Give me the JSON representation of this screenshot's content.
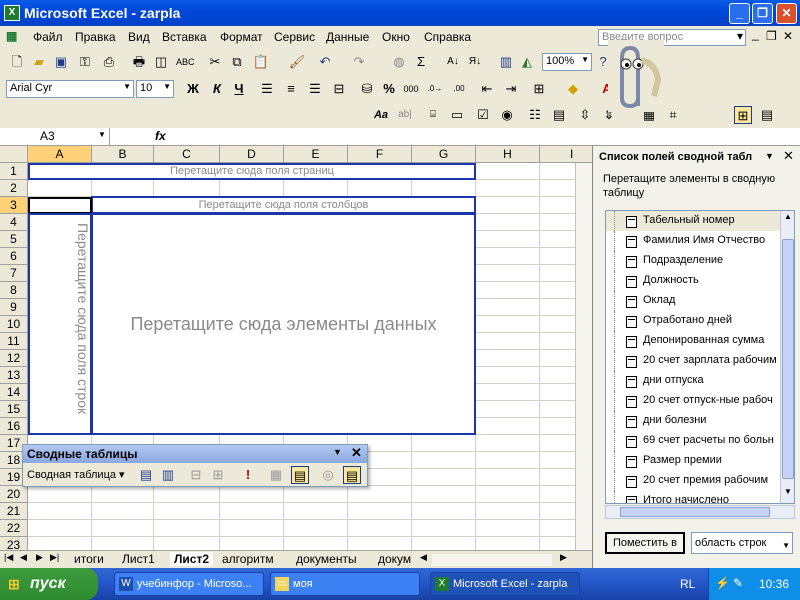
{
  "window": {
    "title": "Microsoft Excel - zarpla",
    "app_icon": "excel-icon",
    "minimize": "_",
    "maximize": "❐",
    "close": "✕"
  },
  "menu": {
    "items": [
      "Файл",
      "Правка",
      "Вид",
      "Вставка",
      "Формат",
      "Сервис",
      "Данные",
      "Окно",
      "Справка"
    ],
    "help_placeholder": "Введите вопрос",
    "doc_controls": [
      "▾",
      "_",
      "❐",
      "✕"
    ]
  },
  "toolbar": {
    "zoom": "100%",
    "font": "Arial Cyr",
    "size": "10",
    "bold": "Ж",
    "italic": "К",
    "underline": "Ч"
  },
  "formula_bar": {
    "name_box": "A3",
    "fx": "fx",
    "formula": ""
  },
  "grid": {
    "columns": [
      "A",
      "B",
      "C",
      "D",
      "E",
      "F",
      "G",
      "H",
      "I"
    ],
    "rows": [
      "1",
      "2",
      "3",
      "4",
      "5",
      "6",
      "7",
      "8",
      "9",
      "10",
      "11",
      "12",
      "13",
      "14",
      "15",
      "16",
      "17",
      "18",
      "19",
      "20",
      "21",
      "22",
      "23"
    ],
    "drop_pages": "Перетащите сюда поля страниц",
    "drop_columns": "Перетащите сюда поля столбцов",
    "drop_rows": "Перетащите сюда поля строк",
    "drop_data": "Перетащите сюда элементы данных"
  },
  "sheet_tabs": {
    "tabs": [
      "итоги",
      "Лист1",
      "Лист2",
      "алгоритм",
      "документы",
      "докум"
    ],
    "active": "Лист2"
  },
  "pivot_toolbar": {
    "title": "Сводные таблицы",
    "menu_label": "Сводная таблица"
  },
  "field_panel": {
    "title": "Список полей сводной табл",
    "hint": "Перетащите элементы в сводную таблицу",
    "fields": [
      "Табельный номер",
      "Фамилия Имя Отчество",
      " Подразделение",
      "Должность",
      "Оклад",
      "Отработано дней",
      "Депонированная сумма",
      "20 счет зарплата рабочим",
      "дни отпуска",
      "20 счет отпуск-ные рабоч",
      "дни болезни",
      "69 счет расчеты по больн",
      "Размер премии",
      "20 счет премия рабочим",
      "Итого начислено"
    ],
    "button": "Поместить в",
    "target": "область строк"
  },
  "taskbar": {
    "start": "пуск",
    "tasks": [
      "учебинфор - Microso...",
      "моя",
      "Microsoft Excel - zarpla"
    ],
    "active_task": "Microsoft Excel - zarpla",
    "lang": "RL",
    "time": "10:36"
  }
}
